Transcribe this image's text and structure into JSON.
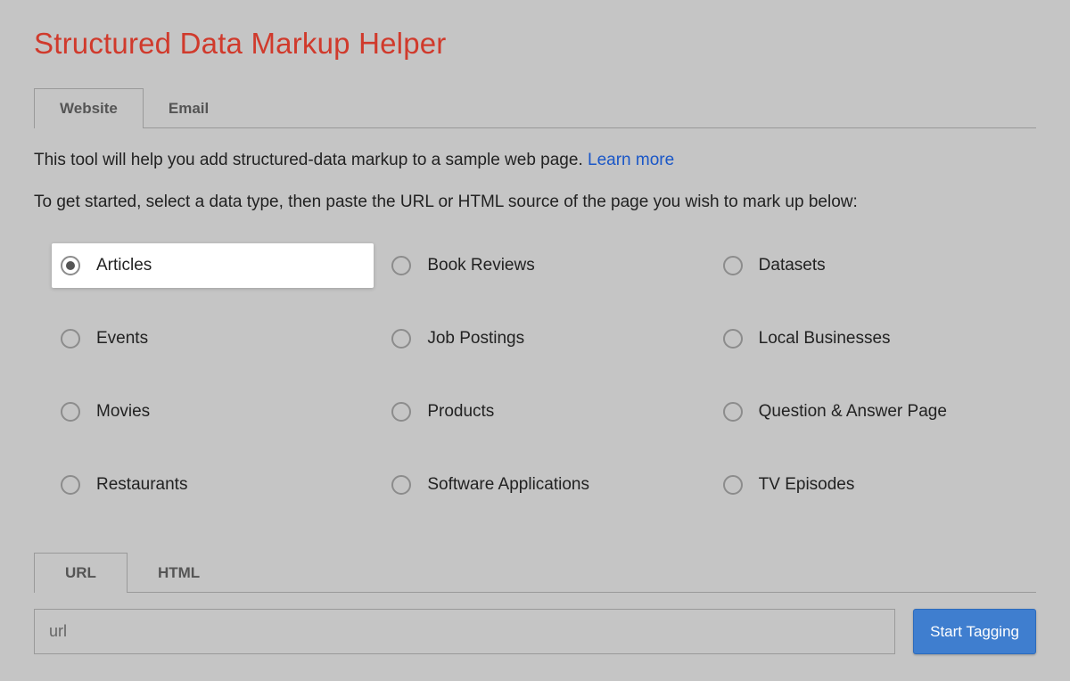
{
  "title": "Structured Data Markup Helper",
  "tabs": {
    "website": "Website",
    "email": "Email"
  },
  "intro_text": "This tool will help you add structured-data markup to a sample web page. ",
  "learn_more": "Learn more",
  "instruction": "To get started, select a data type, then paste the URL or HTML source of the page you wish to mark up below:",
  "options": [
    {
      "label": "Articles",
      "selected": true
    },
    {
      "label": "Book Reviews",
      "selected": false
    },
    {
      "label": "Datasets",
      "selected": false
    },
    {
      "label": "Events",
      "selected": false
    },
    {
      "label": "Job Postings",
      "selected": false
    },
    {
      "label": "Local Businesses",
      "selected": false
    },
    {
      "label": "Movies",
      "selected": false
    },
    {
      "label": "Products",
      "selected": false
    },
    {
      "label": "Question & Answer Page",
      "selected": false
    },
    {
      "label": "Restaurants",
      "selected": false
    },
    {
      "label": "Software Applications",
      "selected": false
    },
    {
      "label": "TV Episodes",
      "selected": false
    }
  ],
  "input_tabs": {
    "url": "URL",
    "html": "HTML"
  },
  "url_placeholder": "url",
  "start_button": "Start Tagging"
}
